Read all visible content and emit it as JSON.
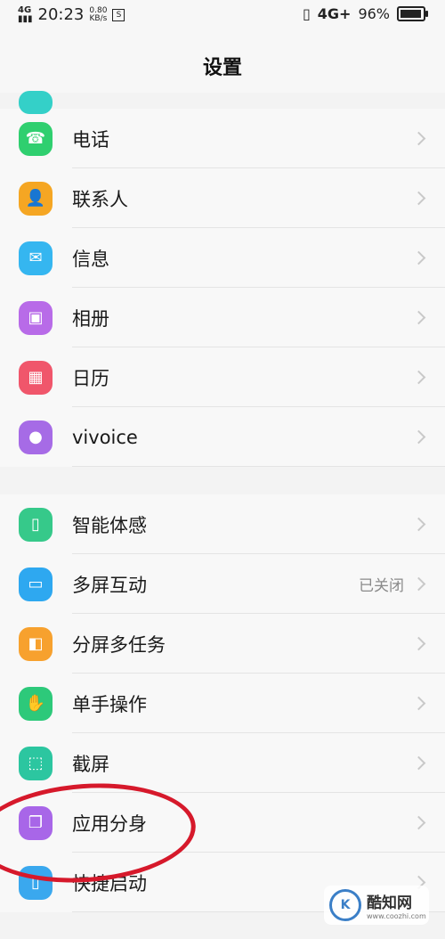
{
  "status_bar": {
    "signal_label": "4G",
    "time": "20:23",
    "speed_value": "0.80",
    "speed_unit": "KB/s",
    "sim_badge": "S",
    "network": "4G+",
    "battery_percent": "96%",
    "battery_level": 0.96
  },
  "header": {
    "title": "设置"
  },
  "group1": {
    "items": [
      {
        "label": "电话",
        "icon": "phone-icon",
        "color": "#2fcf6f"
      },
      {
        "label": "联系人",
        "icon": "contact-icon",
        "color": "#f5a623"
      },
      {
        "label": "信息",
        "icon": "message-icon",
        "color": "#35b6f0"
      },
      {
        "label": "相册",
        "icon": "album-icon",
        "color": "#b86be8"
      },
      {
        "label": "日历",
        "icon": "calendar-icon",
        "color": "#f0566b"
      },
      {
        "label": "vivoice",
        "icon": "microphone-icon",
        "color": "#a66be6"
      }
    ]
  },
  "group2": {
    "items": [
      {
        "label": "智能体感",
        "icon": "motion-phone-icon",
        "color": "#36c98a"
      },
      {
        "label": "多屏互动",
        "icon": "screen-cast-icon",
        "color": "#2ea8f0",
        "status": "已关闭"
      },
      {
        "label": "分屏多任务",
        "icon": "split-screen-icon",
        "color": "#f7a12e"
      },
      {
        "label": "单手操作",
        "icon": "one-hand-icon",
        "color": "#2dc97a"
      },
      {
        "label": "截屏",
        "icon": "screenshot-icon",
        "color": "#2cc6a0"
      },
      {
        "label": "应用分身",
        "icon": "app-clone-icon",
        "color": "#a866e8"
      },
      {
        "label": "快捷启动",
        "icon": "quick-launch-icon",
        "color": "#3aa8ee"
      }
    ]
  },
  "watermark": {
    "logo": "K",
    "name": "酷知网",
    "url": "www.coozhi.com"
  }
}
